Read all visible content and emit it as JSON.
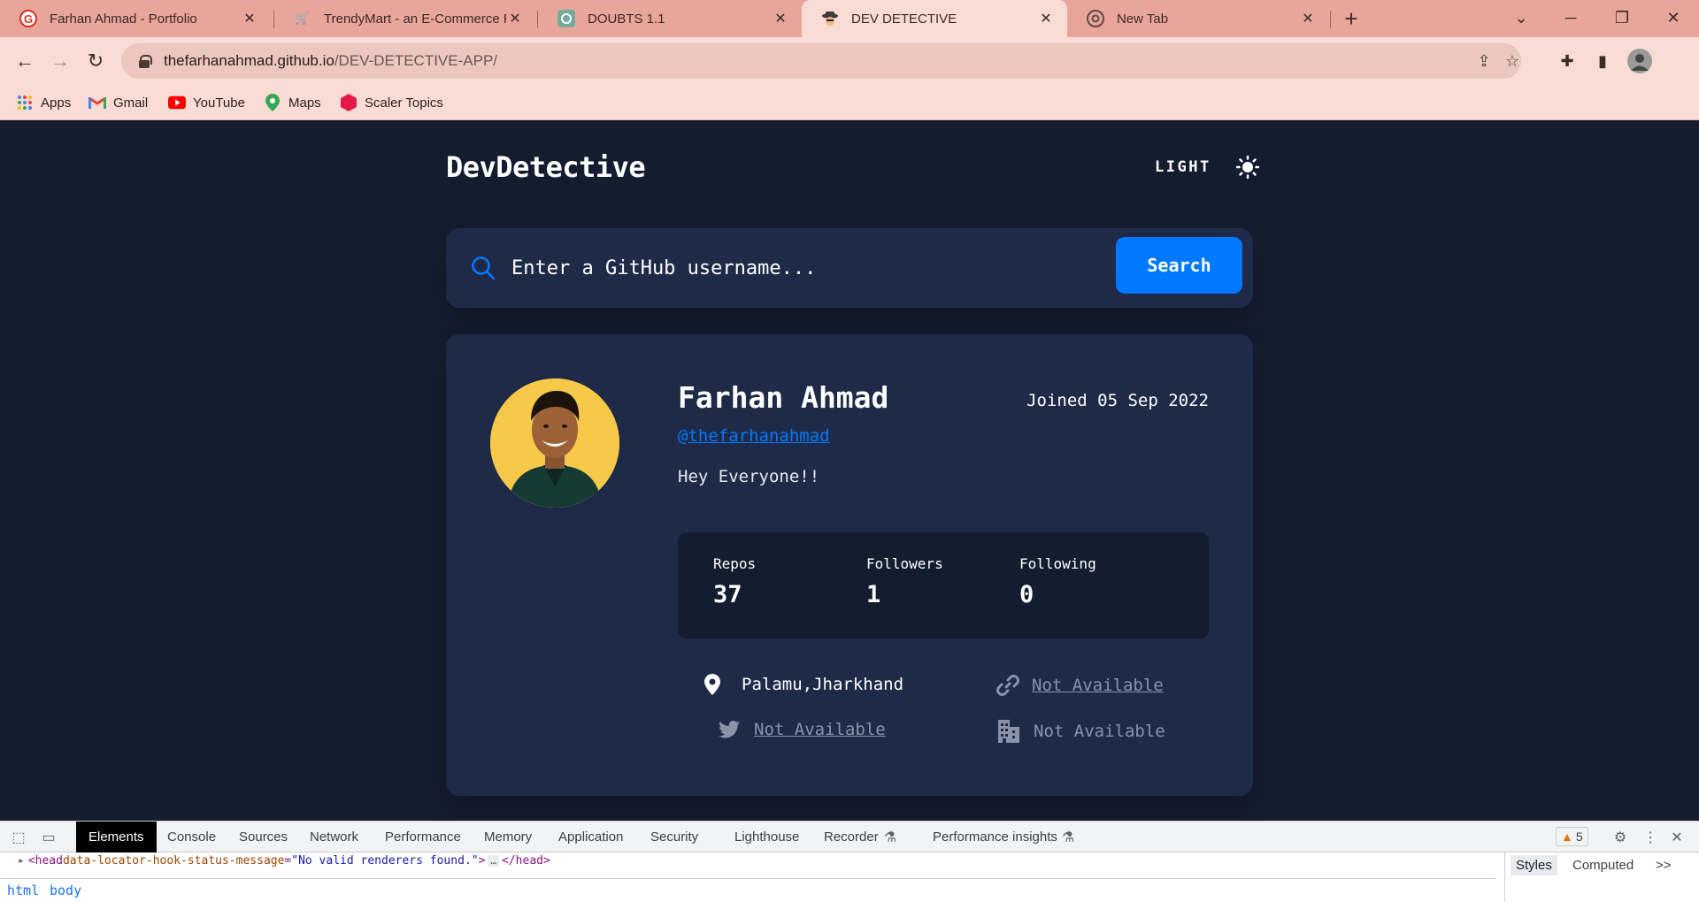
{
  "browser": {
    "tabs": [
      {
        "title": "Farhan Ahmad - Portfolio",
        "icon": "portfolio-favicon",
        "active": false
      },
      {
        "title": "TrendyMart - an E-Commerce Pla",
        "icon": "cart-favicon",
        "active": false
      },
      {
        "title": "DOUBTS 1.1",
        "icon": "chatgpt-favicon",
        "active": false
      },
      {
        "title": "DEV DETECTIVE",
        "icon": "detective-favicon",
        "active": true
      },
      {
        "title": "New Tab",
        "icon": "chrome-favicon",
        "active": false
      }
    ],
    "url_domain": "thefarhanahmad.github.io",
    "url_path": "/DEV-DETECTIVE-APP/",
    "bookmarks": [
      {
        "label": "Apps",
        "icon": "apps-grid-icon"
      },
      {
        "label": "Gmail",
        "icon": "gmail-icon"
      },
      {
        "label": "YouTube",
        "icon": "youtube-icon"
      },
      {
        "label": "Maps",
        "icon": "maps-icon"
      },
      {
        "label": "Scaler Topics",
        "icon": "scaler-icon"
      }
    ]
  },
  "app": {
    "brand": "DevDetective",
    "mode_label": "LIGHT",
    "search": {
      "placeholder": "Enter a GitHub username...",
      "button": "Search"
    },
    "profile": {
      "name": "Farhan Ahmad",
      "joined": "Joined 05 Sep 2022",
      "handle": "@thefarhanahmad",
      "bio": "Hey Everyone!!",
      "stats": [
        {
          "label": "Repos",
          "value": "37"
        },
        {
          "label": "Followers",
          "value": "1"
        },
        {
          "label": "Following",
          "value": "0"
        }
      ],
      "location": "Palamu,Jharkhand",
      "website": "Not Available",
      "twitter": "Not Available",
      "company": "Not Available"
    }
  },
  "devtools": {
    "tabs": [
      "Elements",
      "Console",
      "Sources",
      "Network",
      "Performance",
      "Memory",
      "Application",
      "Security",
      "Lighthouse",
      "Recorder",
      "Performance insights"
    ],
    "warnings": "5",
    "code_open": "<head ",
    "code_attr": "data-locator-hook-status-message",
    "code_eq": "=",
    "code_val": "\"No valid renderers found.\"",
    "code_gt": ">",
    "code_ellipsis": "…",
    "code_close": "</head>",
    "breadcrumbs": [
      "html",
      "body"
    ],
    "side_tabs": [
      "Styles",
      "Computed"
    ],
    "side_more": ">>"
  },
  "colors": {
    "page_bg": "#141d2f",
    "card_bg": "#1e2a47",
    "accent": "#0079ff",
    "tabstrip": "#e8a59a",
    "toolbar": "#f9dcd6"
  }
}
